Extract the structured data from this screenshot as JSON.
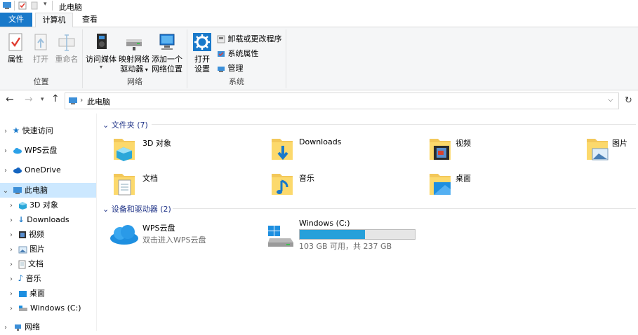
{
  "window": {
    "title": "此电脑"
  },
  "tabs": [
    {
      "label": "文件"
    },
    {
      "label": "计算机"
    },
    {
      "label": "查看"
    }
  ],
  "ribbon": {
    "location": {
      "label": "位置",
      "properties": "属性",
      "open": "打开",
      "rename": "重命名"
    },
    "network": {
      "label": "网络",
      "access_media": "访问媒体",
      "map_drive": "映射网络",
      "map_drive2": "驱动器",
      "add_location": "添加一个",
      "add_location2": "网络位置"
    },
    "system": {
      "label": "系统",
      "open_settings": "打开",
      "open_settings2": "设置",
      "uninstall": "卸载或更改程序",
      "sys_props": "系统属性",
      "manage": "管理"
    }
  },
  "address": {
    "path": "此电脑"
  },
  "nav": {
    "items": [
      {
        "label": "快速访问"
      },
      {
        "label": "WPS云盘"
      },
      {
        "label": "OneDrive"
      },
      {
        "label": "此电脑"
      },
      {
        "label": "3D 对象"
      },
      {
        "label": "Downloads"
      },
      {
        "label": "视频"
      },
      {
        "label": "图片"
      },
      {
        "label": "文档"
      },
      {
        "label": "音乐"
      },
      {
        "label": "桌面"
      },
      {
        "label": "Windows (C:)"
      },
      {
        "label": "网络"
      }
    ]
  },
  "folders": {
    "header": "文件夹 (7)",
    "items": [
      {
        "label": "3D 对象"
      },
      {
        "label": "Downloads"
      },
      {
        "label": "视频"
      },
      {
        "label": "图片"
      },
      {
        "label": "文档"
      },
      {
        "label": "音乐"
      },
      {
        "label": "桌面"
      }
    ]
  },
  "devices": {
    "header": "设备和驱动器 (2)",
    "wps": {
      "name": "WPS云盘",
      "desc": "双击进入WPS云盘"
    },
    "drive": {
      "name": "Windows (C:)",
      "space": "103 GB 可用，共 237 GB",
      "used_fraction": 0.565
    }
  },
  "colors": {
    "accent": "#1979ca",
    "selection": "#cce8ff",
    "drive_bar": "#26a0da"
  }
}
